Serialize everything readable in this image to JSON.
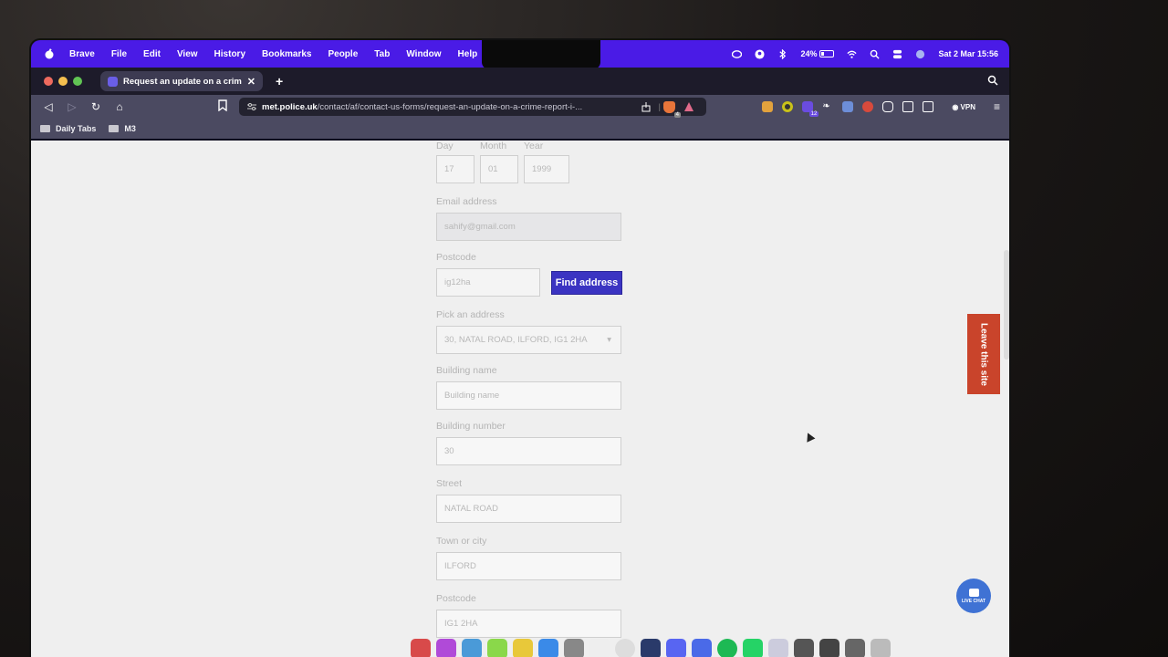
{
  "menubar": {
    "app_name": "Brave",
    "items": [
      "File",
      "Edit",
      "View",
      "History",
      "Bookmarks",
      "People",
      "Tab",
      "Window",
      "Help"
    ],
    "battery": "24%",
    "battery_level": 0.24,
    "datetime": "Sat 2 Mar  15:56",
    "status_icons": [
      "creative-cloud-icon",
      "user-icon",
      "bluetooth-icon",
      "battery-icon",
      "wifi-icon",
      "spotlight-search-icon",
      "control-center-icon",
      "siri-icon"
    ]
  },
  "browser": {
    "tab_title": "Request an update on a crime report",
    "new_tab_label": "+",
    "url_domain": "met.police.uk",
    "url_path": "/contact/af/contact-us-forms/request-an-update-on-a-crime-report-i-...",
    "shields_badge": "4",
    "extension_badge": "12",
    "vpn_label": "VPN",
    "bookmarks": [
      "Daily Tabs",
      "M3"
    ]
  },
  "form": {
    "dob": {
      "day_label": "Day",
      "day_value": "17",
      "month_label": "Month",
      "month_value": "01",
      "year_label": "Year",
      "year_value": "1999"
    },
    "email_label": "Email address",
    "email_value": "sahify@gmail.com",
    "postcode_label": "Postcode",
    "postcode_value": "ig12ha",
    "find_address_label": "Find address",
    "pick_address_label": "Pick an address",
    "pick_address_value": "30, NATAL ROAD, ILFORD, IG1 2HA",
    "building_name_label": "Building name",
    "building_name_placeholder": "Building name",
    "building_number_label": "Building number",
    "building_number_value": "30",
    "street_label": "Street",
    "street_value": "NATAL ROAD",
    "town_label": "Town or city",
    "town_value": "ILFORD",
    "postcode2_label": "Postcode",
    "postcode2_value": "IG1 2HA"
  },
  "page": {
    "leave_site_label": "Leave this site",
    "live_chat_label": "LIVE CHAT"
  }
}
